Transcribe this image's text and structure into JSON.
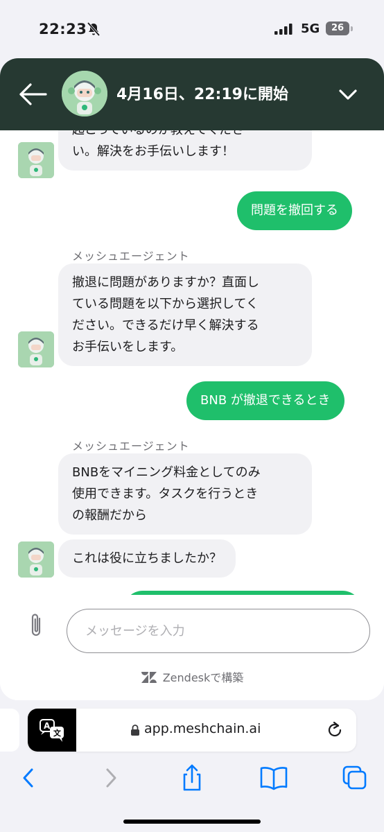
{
  "status_bar": {
    "time": "22:23",
    "network": "5G",
    "battery": "26",
    "icons": [
      "bell-slash-icon",
      "signal-icon",
      "battery-icon"
    ]
  },
  "chat": {
    "header": {
      "title": "4月16日、22:19に開始",
      "icons": [
        "back-arrow-icon",
        "avatar",
        "chevron-down-icon"
      ]
    },
    "messages": [
      {
        "from": "agent",
        "text": "起こっているのか教えてくださ\nい。解決をお手伝いします！"
      },
      {
        "from": "user",
        "text": "問題を撤回する"
      },
      {
        "from": "agent",
        "sender": "メッシュエージェント",
        "text": "撤退に問題がありますか？直面し\nている問題を以下から選択してく\nださい。できるだけ早く解決する\nお手伝いをします。"
      },
      {
        "from": "user",
        "text": "BNB が撤退できるとき"
      },
      {
        "from": "agent",
        "sender": "メッシュエージェント",
        "text": "BNBをマイニング料金としてのみ\n使用できます。タスクを行うとき\nの報酬だから"
      },
      {
        "from": "agent",
        "text": "これは役に立ちましたか？"
      }
    ],
    "composer": {
      "placeholder": "メッセージを入力",
      "attach_icon": "paperclip-icon"
    },
    "powered_by": "Zendeskで構築"
  },
  "browser": {
    "url": "app.meshchain.ai",
    "icons": [
      "translate-icon",
      "lock-icon",
      "reload-icon",
      "back-icon",
      "forward-icon",
      "share-icon",
      "bookmarks-icon",
      "tabs-icon"
    ]
  },
  "colors": {
    "header_bg": "#263932",
    "user_bubble": "#1fbf6b",
    "agent_bubble": "#f1f1f4",
    "browser_accent": "#007aff"
  }
}
